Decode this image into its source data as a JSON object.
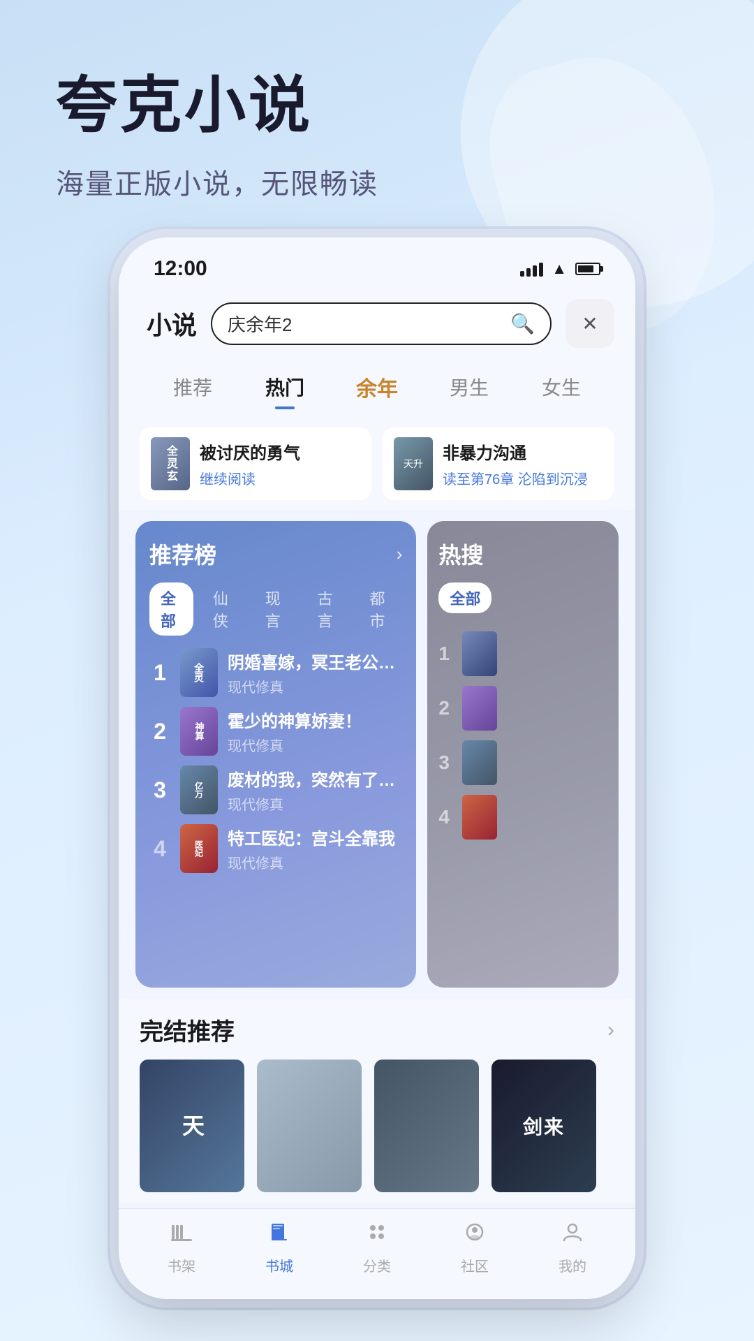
{
  "app": {
    "title": "夸克小说",
    "subtitle": "海量正版小说，无限畅读"
  },
  "status_bar": {
    "time": "12:00",
    "signal_label": "signal",
    "wifi_label": "wifi",
    "battery_label": "battery"
  },
  "header": {
    "nav_title": "小说",
    "search_placeholder": "庆余年2",
    "close_label": "×"
  },
  "tabs": [
    {
      "label": "推荐",
      "active": false,
      "special": false
    },
    {
      "label": "热门",
      "active": true,
      "special": false
    },
    {
      "label": "余年",
      "active": false,
      "special": true
    },
    {
      "label": "男生",
      "active": false,
      "special": false
    },
    {
      "label": "女生",
      "active": false,
      "special": false
    }
  ],
  "recent_books": [
    {
      "name": "被讨厌的勇气",
      "progress": "继续阅读"
    },
    {
      "name": "非暴力沟通",
      "progress": "读至第76章 沦陷到沉浸"
    }
  ],
  "rank_panel": {
    "title": "推荐榜",
    "arrow": "›",
    "sub_tabs": [
      "全部",
      "仙侠",
      "现言",
      "古言",
      "都市"
    ],
    "active_sub_tab": "全部",
    "items": [
      {
        "rank": "1",
        "name": "阴婚喜嫁，冥王老公沦陷了",
        "genre": "现代修真"
      },
      {
        "rank": "2",
        "name": "霍少的神算娇妻！",
        "genre": "现代修真"
      },
      {
        "rank": "3",
        "name": "废材的我，突然有了亿万年",
        "genre": "现代修真"
      },
      {
        "rank": "4",
        "name": "特工医妃：宫斗全靠我",
        "genre": "现代修真"
      }
    ]
  },
  "hot_panel": {
    "title": "热搜",
    "sub_tabs": [
      "全部"
    ],
    "items": [
      {
        "rank": "1"
      },
      {
        "rank": "2"
      },
      {
        "rank": "3"
      },
      {
        "rank": "4"
      }
    ]
  },
  "complete_section": {
    "title": "完结推荐",
    "arrow": "›",
    "books": [
      {
        "label": "天"
      },
      {
        "label": ""
      },
      {
        "label": ""
      },
      {
        "label": "剑来"
      }
    ]
  },
  "bottom_nav": {
    "items": [
      {
        "label": "书架",
        "icon": "shelf",
        "active": false
      },
      {
        "label": "书城",
        "icon": "book",
        "active": true
      },
      {
        "label": "分类",
        "icon": "grid",
        "active": false
      },
      {
        "label": "社区",
        "icon": "community",
        "active": false
      },
      {
        "label": "我的",
        "icon": "profile",
        "active": false
      }
    ]
  }
}
